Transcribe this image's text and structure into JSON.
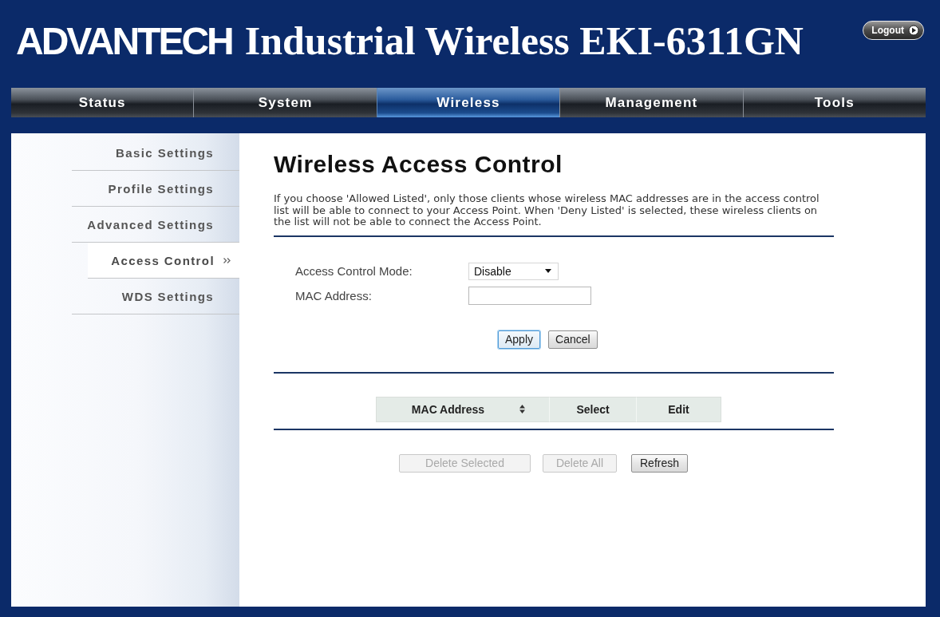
{
  "header": {
    "logo": "ADVANTECH",
    "title": "Industrial Wireless EKI-6311GN",
    "logout": "Logout"
  },
  "tabs": [
    {
      "label": "Status",
      "selected": false
    },
    {
      "label": "System",
      "selected": false
    },
    {
      "label": "Wireless",
      "selected": true
    },
    {
      "label": "Management",
      "selected": false
    },
    {
      "label": "Tools",
      "selected": false
    }
  ],
  "sidebar": {
    "items": [
      {
        "label": "Basic Settings",
        "selected": false
      },
      {
        "label": "Profile Settings",
        "selected": false
      },
      {
        "label": "Advanced Settings",
        "selected": false
      },
      {
        "label": "Access Control",
        "selected": true
      },
      {
        "label": "WDS Settings",
        "selected": false
      }
    ]
  },
  "page": {
    "title": "Wireless Access Control",
    "description": "If you choose 'Allowed Listed', only those clients whose wireless MAC addresses are in the access control list will be able to connect to your Access Point. When 'Deny Listed' is selected, these wireless clients on the list will not be able to connect the Access Point."
  },
  "form": {
    "fields": [
      {
        "kind": "select",
        "label": "Access Control Mode:",
        "value": "Disable"
      },
      {
        "kind": "text",
        "label": "MAC Address:"
      }
    ],
    "buttons": [
      {
        "label": "Apply",
        "focused": true
      },
      {
        "label": "Cancel",
        "focused": false
      }
    ]
  },
  "table": {
    "columns": [
      {
        "label": "MAC Address",
        "sortable": true
      },
      {
        "label": "Select",
        "sortable": false
      },
      {
        "label": "Edit",
        "sortable": false
      }
    ],
    "buttons": [
      {
        "label": "Delete Selected",
        "disabled": true
      },
      {
        "label": "Delete All",
        "disabled": true
      },
      {
        "label": "Refresh",
        "disabled": false
      }
    ]
  }
}
